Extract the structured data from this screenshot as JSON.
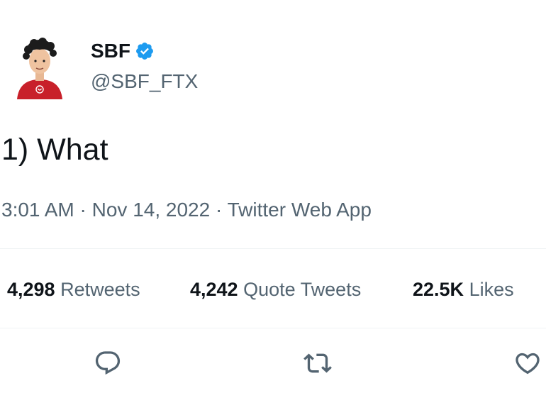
{
  "author": {
    "display_name": "SBF",
    "handle": "@SBF_FTX",
    "verified": true,
    "avatar_icon": "cartoon-avatar"
  },
  "tweet": {
    "text": "1) What",
    "time": "3:01 AM",
    "separator": "·",
    "date": "Nov 14, 2022",
    "source": "Twitter Web App"
  },
  "stats": {
    "retweets": {
      "count": "4,298",
      "label": "Retweets"
    },
    "quote_tweets": {
      "count": "4,242",
      "label": "Quote Tweets"
    },
    "likes": {
      "count": "22.5K",
      "label": "Likes"
    }
  },
  "actions": {
    "reply_icon": "reply-icon",
    "retweet_icon": "retweet-icon",
    "like_icon": "heart-icon"
  },
  "colors": {
    "text_primary": "#0f1419",
    "text_secondary": "#536471",
    "verified_blue": "#1d9bf0",
    "divider": "#eff3f4",
    "avatar_shirt": "#c8202a"
  }
}
